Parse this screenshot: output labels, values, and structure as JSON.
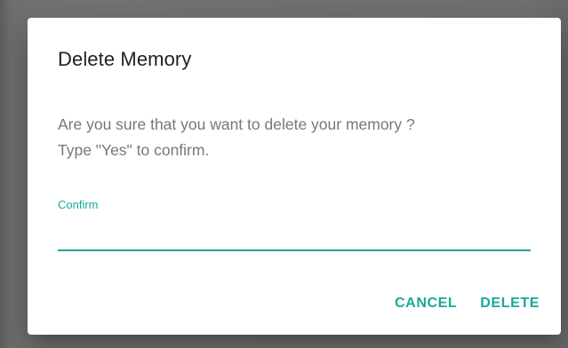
{
  "dialog": {
    "title": "Delete Memory",
    "message_line1": "Are you sure that you want to delete your memory ?",
    "message_line2": "Type \"Yes\" to confirm.",
    "confirm_field": {
      "label": "Confirm",
      "value": ""
    },
    "cancel_label": "CANCEL",
    "delete_label": "DELETE"
  },
  "colors": {
    "accent": "#1aa89a",
    "title_text": "#212121",
    "body_text": "#777777",
    "backdrop": "#727272",
    "surface": "#ffffff"
  }
}
